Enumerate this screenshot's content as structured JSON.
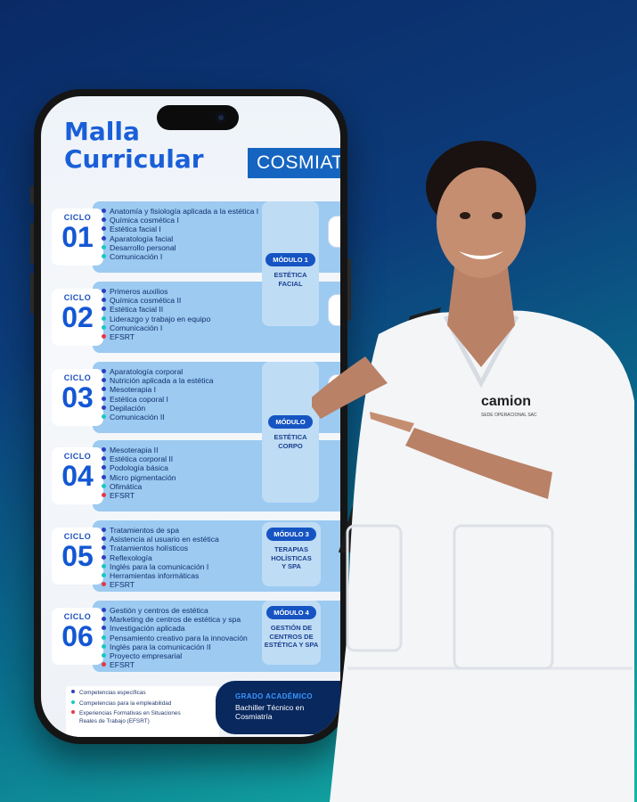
{
  "phone": {
    "title_line1": "Malla",
    "title_line2": "Curricular",
    "program": "COSMIATR",
    "cycles": [
      {
        "label": "CICLO",
        "number": "01",
        "courses": [
          {
            "text": "Anatomía y fisiología aplicada a la estética I",
            "type": "especifica"
          },
          {
            "text": "Química cosmética I",
            "type": "especifica"
          },
          {
            "text": "Estética facial I",
            "type": "especifica"
          },
          {
            "text": "Aparatología facial",
            "type": "especifica"
          },
          {
            "text": "Desarrollo personal",
            "type": "empleabilidad"
          },
          {
            "text": "Comunicación I",
            "type": "empleabilidad"
          }
        ]
      },
      {
        "label": "CICLO",
        "number": "02",
        "courses": [
          {
            "text": "Primeros auxilios",
            "type": "especifica"
          },
          {
            "text": "Química cosmética II",
            "type": "especifica"
          },
          {
            "text": "Estética facial II",
            "type": "especifica"
          },
          {
            "text": "Liderazgo y trabajo en equipo",
            "type": "empleabilidad"
          },
          {
            "text": "Comunicación I",
            "type": "empleabilidad"
          },
          {
            "text": "EFSRT",
            "type": "efsrt"
          }
        ]
      },
      {
        "label": "CICLO",
        "number": "03",
        "courses": [
          {
            "text": "Aparatología corporal",
            "type": "especifica"
          },
          {
            "text": "Nutrición aplicada a la estética",
            "type": "especifica"
          },
          {
            "text": "Mesoterapia I",
            "type": "especifica"
          },
          {
            "text": "Estética coporal I",
            "type": "especifica"
          },
          {
            "text": "Depilación",
            "type": "especifica"
          },
          {
            "text": "Comunicación II",
            "type": "empleabilidad"
          }
        ]
      },
      {
        "label": "CICLO",
        "number": "04",
        "courses": [
          {
            "text": "Mesoterapia II",
            "type": "especifica"
          },
          {
            "text": "Estética corporal II",
            "type": "especifica"
          },
          {
            "text": "Podología básica",
            "type": "especifica"
          },
          {
            "text": "Micro pigmentación",
            "type": "especifica"
          },
          {
            "text": "Ofimática",
            "type": "empleabilidad"
          },
          {
            "text": "EFSRT",
            "type": "efsrt"
          }
        ]
      },
      {
        "label": "CICLO",
        "number": "05",
        "courses": [
          {
            "text": "Tratamientos de spa",
            "type": "especifica"
          },
          {
            "text": "Asistencia al usuario en estética",
            "type": "especifica"
          },
          {
            "text": "Tratamientos holísticos",
            "type": "especifica"
          },
          {
            "text": "Reflexología",
            "type": "especifica"
          },
          {
            "text": "Inglés para la comunicación I",
            "type": "empleabilidad"
          },
          {
            "text": "Herramientas informáticas",
            "type": "empleabilidad"
          },
          {
            "text": "EFSRT",
            "type": "efsrt"
          }
        ]
      },
      {
        "label": "CICLO",
        "number": "06",
        "courses": [
          {
            "text": "Gestión y centros de estética",
            "type": "especifica"
          },
          {
            "text": "Marketing de centros de estética y spa",
            "type": "especifica"
          },
          {
            "text": "Investigación aplicada",
            "type": "especifica"
          },
          {
            "text": "Pensamiento creativo para la innovación",
            "type": "empleabilidad"
          },
          {
            "text": "Inglés para la comunicación II",
            "type": "empleabilidad"
          },
          {
            "text": "Proyecto empresarial",
            "type": "empleabilidad"
          },
          {
            "text": "EFSRT",
            "type": "efsrt"
          }
        ]
      }
    ],
    "modules": [
      {
        "pill": "MÓDULO 1",
        "name_line1": "ESTÉTICA",
        "name_line2": "FACIAL",
        "name_line3": ""
      },
      {
        "pill": "MÓDULO",
        "name_line1": "ESTÉTICA",
        "name_line2": "CORPO",
        "name_line3": ""
      },
      {
        "pill": "MÓDULO 3",
        "name_line1": "TERAPIAS",
        "name_line2": "HOLÍSTICAS",
        "name_line3": "Y SPA"
      },
      {
        "pill": "MÓDULO 4",
        "name_line1": "GESTIÓN DE",
        "name_line2": "CENTROS DE",
        "name_line3": "ESTÉTICA Y SPA"
      }
    ],
    "legend": {
      "especifica": "Competencias específicas",
      "empleabilidad": "Competencias para la empleabilidad",
      "efsrt_line1": "Experiencias Formativas en Situaciones",
      "efsrt_line2": "Reales de Trabajo (EFSRT)"
    },
    "grado": {
      "heading": "GRADO ACADÉMICO",
      "text": "Bachiller Técnico en Cosmiatría"
    }
  },
  "uniform_logo": {
    "brand": "camion",
    "subtitle": "SEDE OPERACIONAL SAC"
  },
  "colors": {
    "especifica": "#2c3fbf",
    "empleabilidad": "#19c7c2",
    "efsrt": "#e8364a",
    "accent": "#1565c0"
  }
}
